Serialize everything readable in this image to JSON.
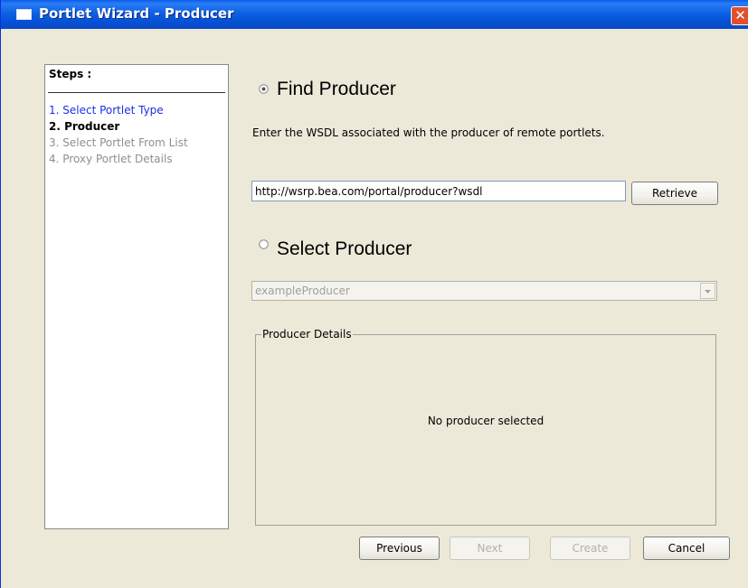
{
  "window": {
    "title": "Portlet Wizard - Producer",
    "close_glyph": "✕"
  },
  "steps": {
    "title": "Steps :",
    "items": [
      {
        "label": "1. Select Portlet Type",
        "state": "link"
      },
      {
        "label": "2. Producer",
        "state": "current"
      },
      {
        "label": "3. Select Portlet From List",
        "state": "disabled"
      },
      {
        "label": "4. Proxy Portlet Details",
        "state": "disabled"
      }
    ]
  },
  "find_producer": {
    "radio_selected": true,
    "heading": "Find Producer",
    "description": "Enter the WSDL associated with the producer of remote portlets.",
    "wsdl_value": "http://wsrp.bea.com/portal/producer?wsdl",
    "retrieve_label": "Retrieve"
  },
  "select_producer": {
    "radio_selected": false,
    "heading": "Select Producer",
    "dropdown_value": "exampleProducer"
  },
  "producer_details": {
    "legend": "Producer Details",
    "empty_text": "No producer selected"
  },
  "footer": {
    "previous_label": "Previous",
    "next_label": "Next",
    "create_label": "Create",
    "cancel_label": "Cancel"
  },
  "colors": {
    "titlebar": "#0551d6",
    "link": "#1c2ee8",
    "disabled_text": "#8f8f8f",
    "dialog_bg": "#ece9d8"
  }
}
